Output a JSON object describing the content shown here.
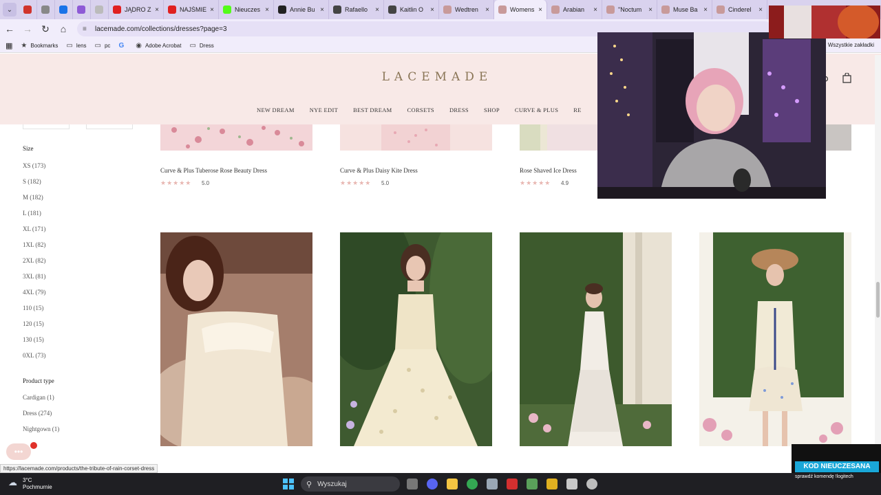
{
  "browser": {
    "tabs": [
      {
        "title": "",
        "color": "#d0342c"
      },
      {
        "title": "",
        "color": "#888888"
      },
      {
        "title": "",
        "color": "#1a73e8"
      },
      {
        "title": "",
        "color": "#8e5ad6"
      },
      {
        "title": "",
        "color": "#bbbbbb"
      },
      {
        "title": "JĄDRO Z",
        "color": "#e02020"
      },
      {
        "title": "NAJŚMIE",
        "color": "#e02020"
      },
      {
        "title": "Nieuczes",
        "color": "#53fc18"
      },
      {
        "title": "Annie Bu",
        "color": "#222222"
      },
      {
        "title": "Rafaello",
        "color": "#444444"
      },
      {
        "title": "Kaitlin O",
        "color": "#444444"
      },
      {
        "title": "Wedtren",
        "color": "#c89a9a"
      },
      {
        "title": "Womens",
        "color": "#c89a9a",
        "active": true
      },
      {
        "title": "Arabian",
        "color": "#c89a9a"
      },
      {
        "title": "\"Noctum",
        "color": "#c89a9a"
      },
      {
        "title": "Muse Ba",
        "color": "#c89a9a"
      },
      {
        "title": "Cinderel",
        "color": "#c89a9a"
      }
    ],
    "url": "lacemade.com/collections/dresses?page=3",
    "bookmarks": [
      {
        "label": "Bookmarks",
        "icon": "star-icon"
      },
      {
        "label": "lens",
        "icon": "folder-icon"
      },
      {
        "label": "pc",
        "icon": "folder-icon"
      },
      {
        "label": "",
        "icon": "google-icon"
      },
      {
        "label": "Adobe Acrobat",
        "icon": "acrobat-icon"
      },
      {
        "label": "Dress",
        "icon": "folder-icon"
      }
    ],
    "all_bookmarks": "Wszystkie zakładki",
    "status_url": "https://lacemade.com/products/the-tribute-of-rain-corset-dress"
  },
  "site": {
    "logo": "LACEMADE",
    "nav": [
      "NEW DREAM",
      "NYE EDIT",
      "BEST DREAM",
      "CORSETS",
      "DRESS",
      "SHOP",
      "CURVE & PLUS",
      "RE"
    ]
  },
  "filters": {
    "size": {
      "title": "Size",
      "options": [
        "XS (173)",
        "S (182)",
        "M (182)",
        "L (181)",
        "XL (171)",
        "1XL (82)",
        "2XL (82)",
        "3XL (81)",
        "4XL (79)",
        "110 (15)",
        "120 (15)",
        "130 (15)",
        "0XL (73)"
      ]
    },
    "product_type": {
      "title": "Product type",
      "options": [
        "Cardigan (1)",
        "Dress (274)",
        "Nightgown (1)"
      ]
    }
  },
  "products_top": [
    {
      "name": "Curve & Plus Tuberose Rose Beauty Dress",
      "rating": "5.0"
    },
    {
      "name": "Curve & Plus Daisy Kite Dress",
      "rating": "5.0"
    },
    {
      "name": "Rose Shaved Ice Dress",
      "rating": "4.9"
    }
  ],
  "promo": {
    "title": "KOD NIEUCZESANA",
    "subtitle": "sprawdź komendę !logitech"
  },
  "taskbar": {
    "temperature": "3°C",
    "weather": "Pochmurnie",
    "search": "Wyszukaj"
  }
}
